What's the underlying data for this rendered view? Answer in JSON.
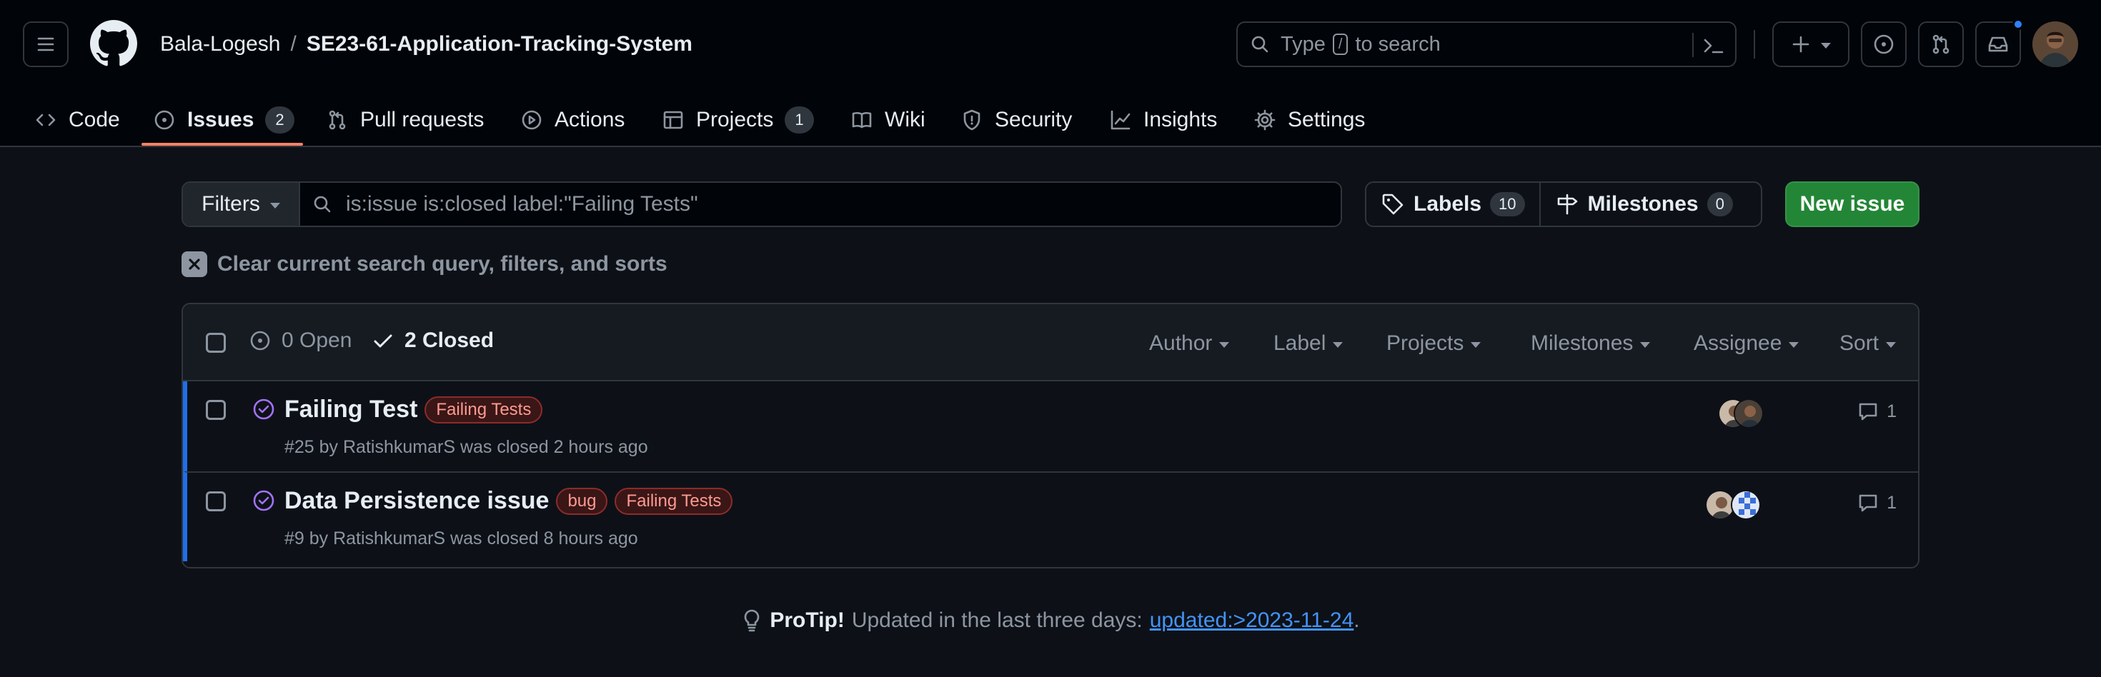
{
  "header": {
    "owner": "Bala-Logesh",
    "separator": "/",
    "repo": "SE23-61-Application-Tracking-System",
    "search": {
      "prefix": "Type",
      "key": "/",
      "suffix": "to search"
    }
  },
  "tabs": [
    {
      "label": "Code",
      "icon": "code-icon"
    },
    {
      "label": "Issues",
      "icon": "issue-opened-icon",
      "counter": "2",
      "active": true
    },
    {
      "label": "Pull requests",
      "icon": "git-pull-request-icon"
    },
    {
      "label": "Actions",
      "icon": "play-icon"
    },
    {
      "label": "Projects",
      "icon": "table-icon",
      "counter": "1"
    },
    {
      "label": "Wiki",
      "icon": "book-icon"
    },
    {
      "label": "Security",
      "icon": "shield-icon"
    },
    {
      "label": "Insights",
      "icon": "graph-icon"
    },
    {
      "label": "Settings",
      "icon": "gear-icon"
    }
  ],
  "toolbar": {
    "filters_label": "Filters",
    "query": "is:issue is:closed label:\"Failing Tests\"",
    "labels_label": "Labels",
    "labels_count": "10",
    "milestones_label": "Milestones",
    "milestones_count": "0",
    "new_issue_label": "New issue",
    "clear_label": "Clear current search query, filters, and sorts"
  },
  "list_header": {
    "open_label": "0 Open",
    "closed_label": "2 Closed",
    "filters": [
      "Author",
      "Label",
      "Projects",
      "Milestones",
      "Assignee",
      "Sort"
    ]
  },
  "issues": [
    {
      "title": "Failing Test",
      "labels": [
        "Failing Tests"
      ],
      "meta": "#25 by RatishkumarS was closed 2 hours ago",
      "comments": "1"
    },
    {
      "title": "Data Persistence issue",
      "labels": [
        "bug",
        "Failing Tests"
      ],
      "meta": "#9 by RatishkumarS was closed 8 hours ago",
      "comments": "1"
    }
  ],
  "protip": {
    "lead": "ProTip!",
    "text": "Updated in the last three days:",
    "link": "updated:>2023-11-24",
    "end": "."
  },
  "colors": {
    "accent_underline": "#f78166",
    "new_issue_green": "#238636",
    "closed_purple": "#a371f7",
    "row_accent_blue": "#1f6feb",
    "link_blue": "#4493f8"
  }
}
